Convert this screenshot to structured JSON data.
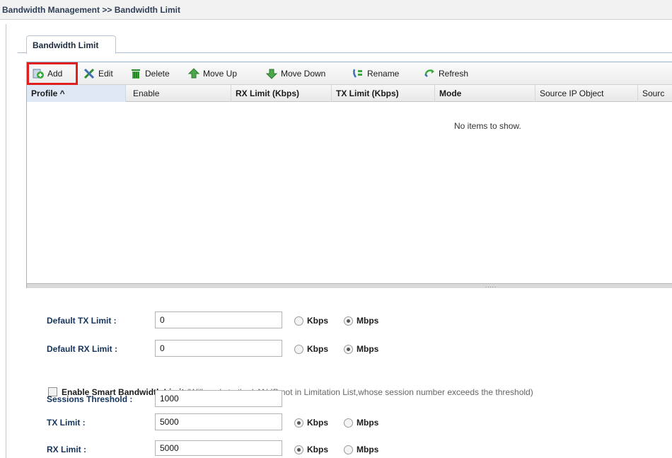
{
  "breadcrumb": "Bandwidth Management >> Bandwidth Limit",
  "tab": {
    "label": "Bandwidth Limit"
  },
  "toolbar": {
    "add": "Add",
    "edit": "Edit",
    "delete": "Delete",
    "move_up": "Move Up",
    "move_down": "Move Down",
    "rename": "Rename",
    "refresh": "Refresh"
  },
  "grid": {
    "columns": [
      "Profile ^",
      "Enable",
      "RX Limit (Kbps)",
      "TX Limit (Kbps)",
      "Mode",
      "Source IP Object",
      "Sourc"
    ],
    "empty_text": "No items to show."
  },
  "form": {
    "default_tx": {
      "label": "Default TX Limit :",
      "value": "0",
      "unit1": "Kbps",
      "unit2": "Mbps",
      "selected": "Mbps"
    },
    "default_rx": {
      "label": "Default RX Limit :",
      "value": "0",
      "unit1": "Kbps",
      "unit2": "Mbps",
      "selected": "Mbps"
    },
    "smart": {
      "label": "Enable Smart Bandwidth Limit",
      "note": "(Will apply to the LAN IP not in Limitation List,whose session number exceeds the threshold)",
      "checked": false
    },
    "sessions": {
      "label": "Sessions Threshold :",
      "value": "1000"
    },
    "tx_limit": {
      "label": "TX Limit :",
      "value": "5000",
      "unit1": "Kbps",
      "unit2": "Mbps",
      "selected": "Kbps"
    },
    "rx_limit": {
      "label": "RX Limit :",
      "value": "5000",
      "unit1": "Kbps",
      "unit2": "Mbps",
      "selected": "Kbps"
    }
  },
  "colors": {
    "label_blue": "#14345c",
    "highlight_red": "#e02020",
    "header_selected": "#dfe9f5"
  }
}
